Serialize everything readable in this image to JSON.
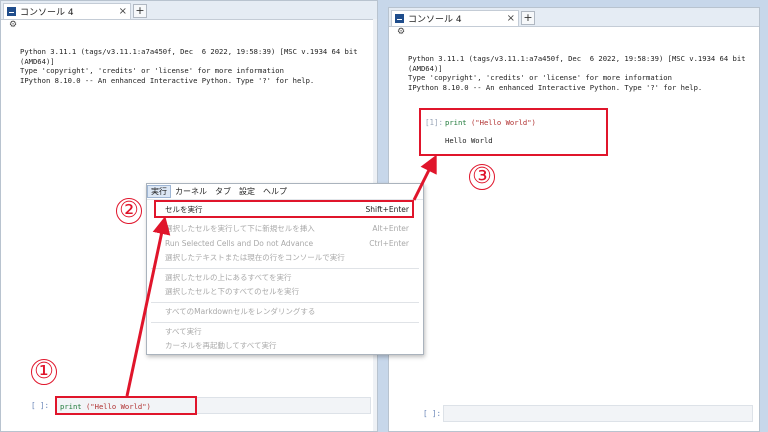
{
  "left_console": {
    "tab_label": "コンソール 4",
    "tab_close": "×",
    "tab_add": "+",
    "banner": "Python 3.11.1 (tags/v3.11.1:a7a450f, Dec  6 2022, 19:58:39) [MSC v.1934 64 bit\n(AMD64)]\nType 'copyright', 'credits' or 'license' for more information\nIPython 8.10.0 -- An enhanced Interactive Python. Type '?' for help.",
    "input_prompt": "[ ]:",
    "input_keyword": "print",
    "input_args": " (\"Hello World\")"
  },
  "right_console": {
    "tab_label": "コンソール 4",
    "tab_close": "×",
    "tab_add": "+",
    "banner": "Python 3.11.1 (tags/v3.11.1:a7a450f, Dec  6 2022, 19:58:39) [MSC v.1934 64 bit\n(AMD64)]\nType 'copyright', 'credits' or 'license' for more information\nIPython 8.10.0 -- An enhanced Interactive Python. Type '?' for help.",
    "cell_prompt": "[1]:",
    "cell_keyword": "print",
    "cell_args": " (\"Hello World\")",
    "output": "Hello World",
    "input_prompt": "[ ]:"
  },
  "menu": {
    "bar": [
      "実行",
      "カーネル",
      "タブ",
      "設定",
      "ヘルプ"
    ],
    "items": [
      {
        "label": "セルを実行",
        "shortcut": "Shift+Enter",
        "enabled": true
      },
      {
        "label": "選択したセルを実行して下に新規セルを挿入",
        "shortcut": "Alt+Enter",
        "enabled": false
      },
      {
        "label": "Run Selected Cells and Do not Advance",
        "shortcut": "Ctrl+Enter",
        "enabled": false
      },
      {
        "label": "選択したテキストまたは現在の行をコンソールで実行",
        "shortcut": "",
        "enabled": false
      },
      {
        "label": "選択したセルの上にあるすべてを実行",
        "shortcut": "",
        "enabled": false
      },
      {
        "label": "選択したセルと下のすべてのセルを実行",
        "shortcut": "",
        "enabled": false
      },
      {
        "label": "すべてのMarkdownセルをレンダリングする",
        "shortcut": "",
        "enabled": false
      },
      {
        "label": "すべて実行",
        "shortcut": "",
        "enabled": false
      },
      {
        "label": "カーネルを再起動してすべて実行",
        "shortcut": "",
        "enabled": false
      }
    ]
  },
  "annotations": {
    "step1": "①",
    "step2": "②",
    "step3": "③",
    "highlight_color": "#e0152b"
  }
}
